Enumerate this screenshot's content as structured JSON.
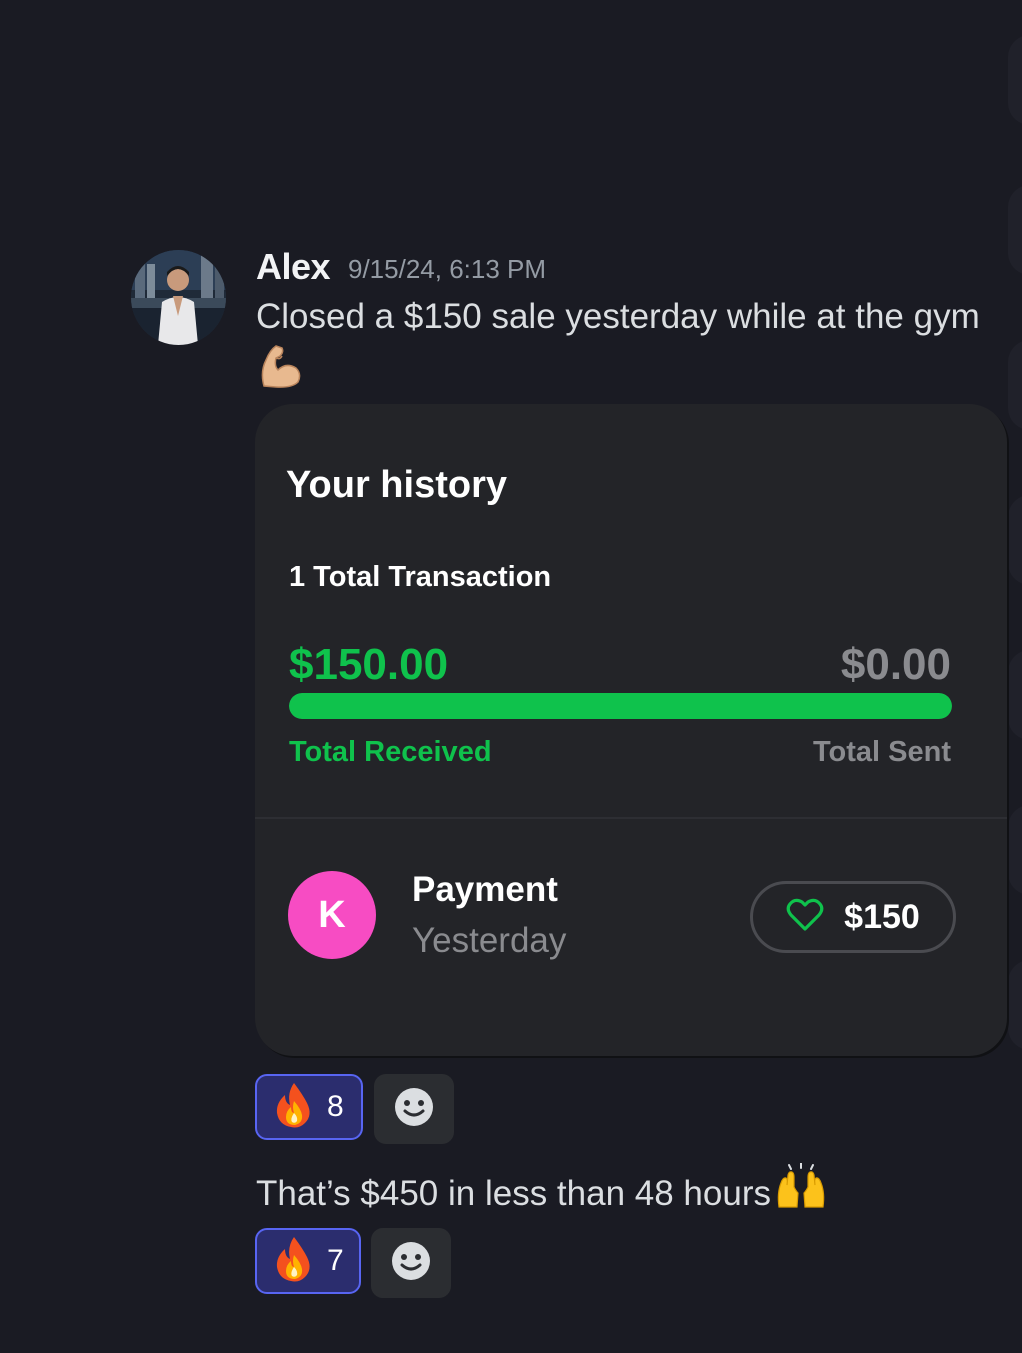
{
  "message": {
    "author": "Alex",
    "timestamp": "9/15/24, 6:13 PM",
    "text": "Closed a $150 sale yesterday while at the gym",
    "emoji": "flexed-biceps"
  },
  "card": {
    "title": "Your history",
    "transaction_count": "1 Total Transaction",
    "received_amount": "$150.00",
    "sent_amount": "$0.00",
    "received_label": "Total Received",
    "sent_label": "Total Sent",
    "received_share": 1.0,
    "payment": {
      "avatar_letter": "K",
      "title": "Payment",
      "when": "Yesterday",
      "amount": "$150"
    }
  },
  "reactions_1": {
    "emoji": "fire",
    "count": "8"
  },
  "followup": {
    "text": "That’s $450 in less than 48 hours",
    "emoji": "raising-hands"
  },
  "reactions_2": {
    "emoji": "fire",
    "count": "7"
  },
  "colors": {
    "background": "#1a1b23",
    "card": "#232428",
    "green": "#0fc24c",
    "pink_avatar": "#f74cc3",
    "reaction_bg": "#2b2d6e",
    "reaction_border": "#5865f2"
  }
}
